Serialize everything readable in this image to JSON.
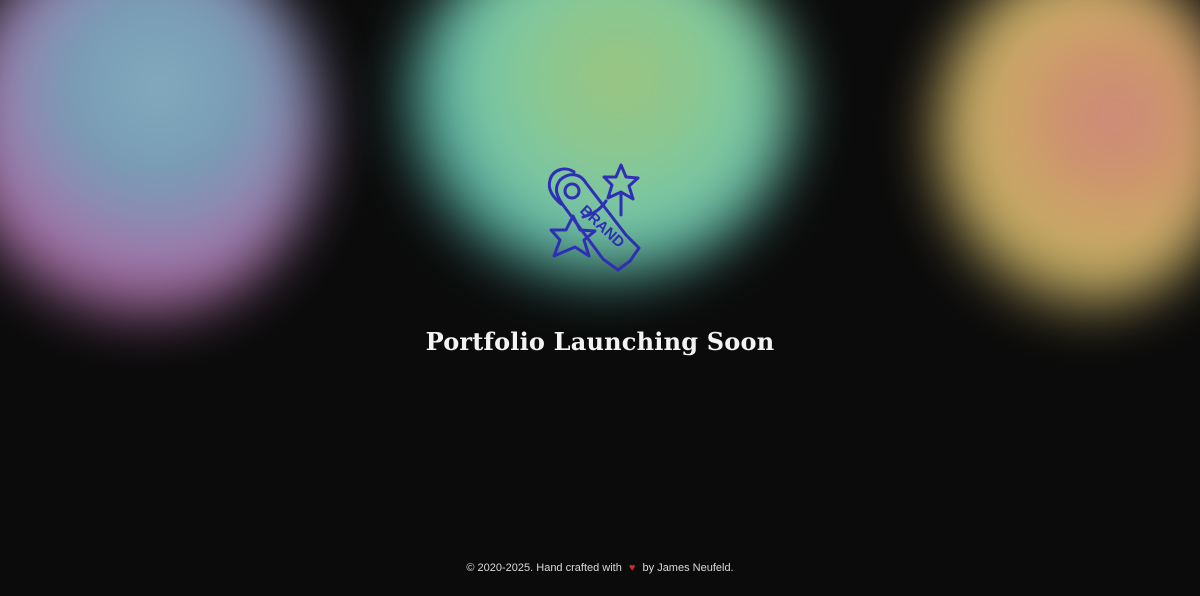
{
  "page": {
    "headline": "Portfolio Launching Soon"
  },
  "logo": {
    "text": "BRAND",
    "icon_name": "brand-tag-with-stars-icon",
    "color": "#2f2fb6"
  },
  "footer": {
    "copyright": "© 2020-2025. Hand crafted with",
    "heart_icon": "heart-icon",
    "author_text": "by James Neufeld."
  },
  "theme": {
    "background": "#0b0b0b",
    "blobs": [
      "#8fb6c7",
      "#7bcfb1",
      "#d4ba6d"
    ]
  }
}
